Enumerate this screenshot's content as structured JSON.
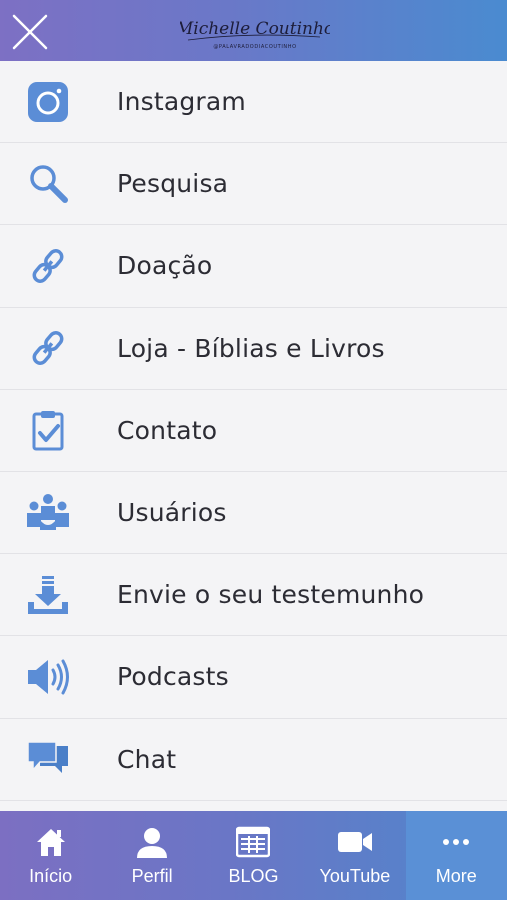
{
  "header": {
    "logo_text": "Michelle Coutinho",
    "logo_subtext": "@PALAVRADODIACOUTINHO"
  },
  "colors": {
    "accent": "#5b8dd6",
    "header_start": "#7d70c4",
    "header_end": "#4a8bd0",
    "text": "#2c2c34"
  },
  "menu": {
    "items": [
      {
        "label": "Instagram",
        "icon": "instagram-icon"
      },
      {
        "label": "Pesquisa",
        "icon": "search-icon"
      },
      {
        "label": "Doação",
        "icon": "link-icon"
      },
      {
        "label": "Loja - Bíblias e Livros",
        "icon": "link-icon"
      },
      {
        "label": "Contato",
        "icon": "clipboard-check-icon"
      },
      {
        "label": "Usuários",
        "icon": "users-icon"
      },
      {
        "label": "Envie o seu testemunho",
        "icon": "download-icon"
      },
      {
        "label": "Podcasts",
        "icon": "speaker-icon"
      },
      {
        "label": "Chat",
        "icon": "chat-icon"
      }
    ]
  },
  "tabbar": {
    "tabs": [
      {
        "label": "Início",
        "icon": "home-icon"
      },
      {
        "label": "Perfil",
        "icon": "profile-icon"
      },
      {
        "label": "BLOG",
        "icon": "blog-icon"
      },
      {
        "label": "YouTube",
        "icon": "video-icon"
      },
      {
        "label": "More",
        "icon": "more-icon",
        "active": true
      }
    ]
  }
}
